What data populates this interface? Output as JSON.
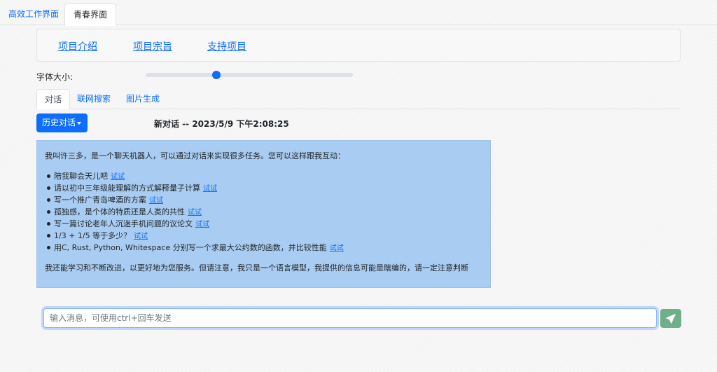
{
  "top_tabs": {
    "efficient": "高效工作界面",
    "youth": "青春界面"
  },
  "nav": {
    "intro": "项目介绍",
    "purpose": "项目宗旨",
    "support": "支持项目"
  },
  "font_size": {
    "label": "字体大小:",
    "level_fraction": 0.34
  },
  "sub_tabs": {
    "chat": "对话",
    "web_search": "联网搜索",
    "image_gen": "图片生成"
  },
  "history_button": "历史对话",
  "conversation_title": "新对话 -- 2023/5/9 下午2:08:25",
  "message": {
    "intro": "我叫许三多，是一个聊天机器人，可以通过对话来实现很多任务。您可以这样跟我互动：",
    "try_label": "试试",
    "items": [
      "陪我聊会天儿吧",
      "请以初中三年级能理解的方式解释量子计算",
      "写一个推广青岛啤酒的方案",
      "孤独感，是个体的特质还是人类的共性",
      "写一篇讨论老年人沉迷手机问题的议论文",
      "1/3 + 1/5 等于多少？",
      "用C, Rust, Python, Whitespace 分别写一个求最大公约数的函数，并比较性能"
    ],
    "outro": "我还能学习和不断改进，以更好地为您服务。但请注意，我只是一个语言模型，我提供的信息可能是瞎编的，请一定注意判断"
  },
  "input": {
    "placeholder": "输入消息，可使用ctrl+回车发送",
    "value": ""
  },
  "icons": {
    "send": "send-icon",
    "caret": "caret-down-icon"
  },
  "colors": {
    "primary": "#0d6efd",
    "message_bg": "#a9cdf2",
    "send_button": "#6fb08a"
  }
}
